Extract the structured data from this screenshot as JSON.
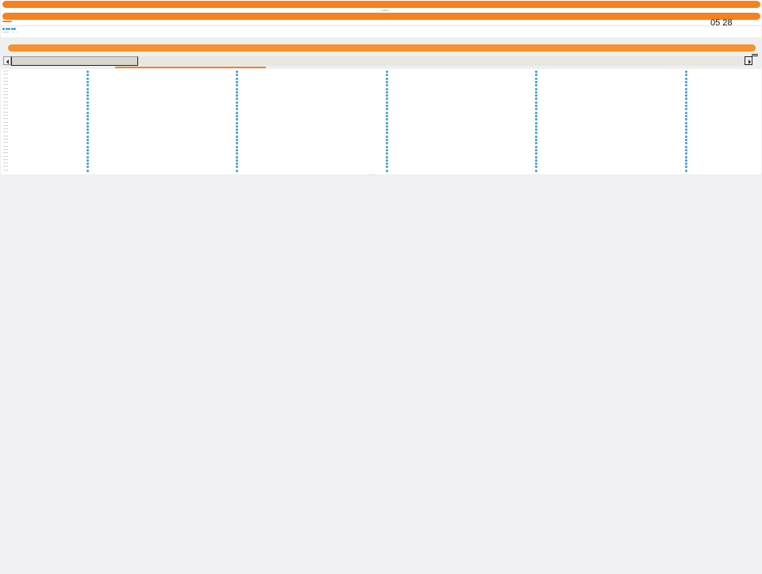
{
  "header": {
    "top_bar_label": "Lorem",
    "second_bar_label": "··",
    "clock": "05 28"
  },
  "status_dots": [
    "active",
    "active",
    "active",
    "active",
    "active"
  ],
  "breadcrumb": [
    "▪ ▪ ▪▪▪▪▪▪▪▪",
    "▪▪▪",
    "▪▪"
  ],
  "scrollbar": {
    "thumb_fraction": 0.17
  },
  "grid": {
    "row_label": "▪▪▪ ▪▪▪▪▪",
    "row_count": 30,
    "columns": [
      "col-1",
      "col-2",
      "col-3",
      "col-4",
      "col-5"
    ]
  },
  "footer": {
    "text": "▪▪ ▪▪▪ ▪▪ ▪▪▪"
  },
  "colors": {
    "accent": "#f5821f",
    "dot": "#3a9ed8",
    "background": "#efeff4"
  }
}
